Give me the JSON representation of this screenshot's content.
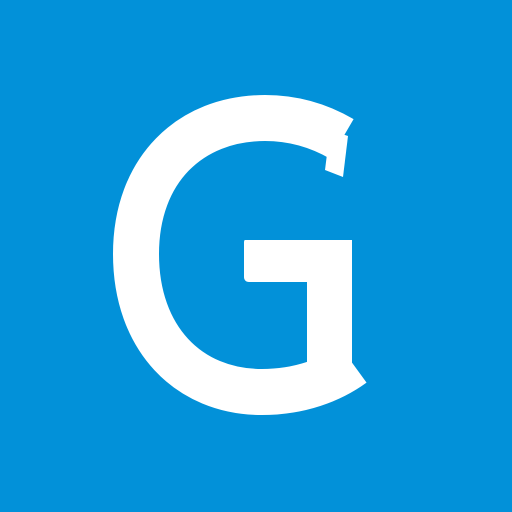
{
  "app_icon": {
    "letter": "G",
    "background_color": "#0291d9",
    "letter_color": "#ffffff"
  }
}
